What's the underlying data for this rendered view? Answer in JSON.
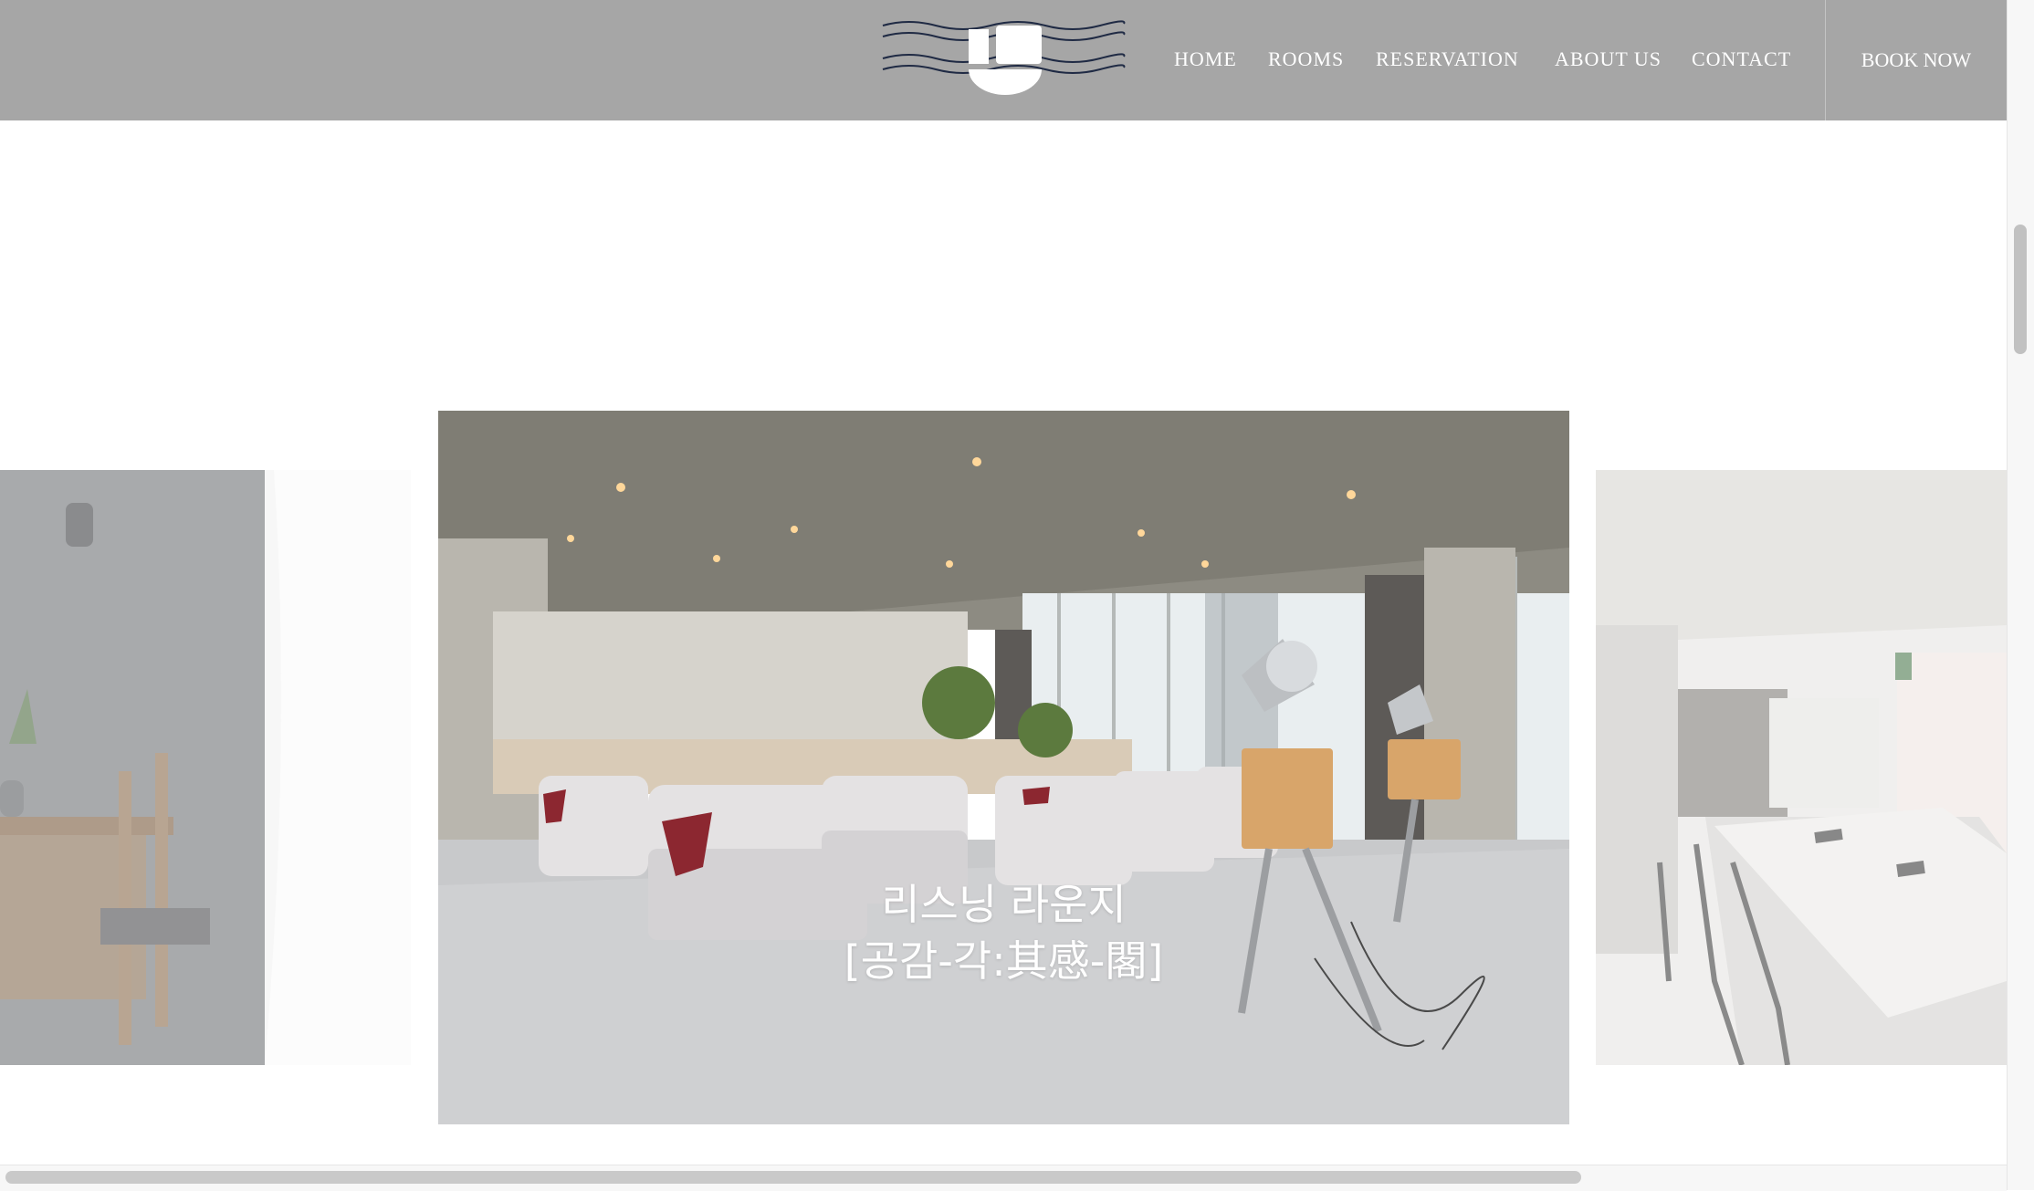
{
  "header": {
    "background": "#a6a6a6",
    "nav": [
      {
        "label": "HOME"
      },
      {
        "label": "ROOMS"
      },
      {
        "label": "RESERVATION"
      },
      {
        "label": "ABOUT US"
      },
      {
        "label": "CONTACT"
      }
    ],
    "cta_label": "BOOK NOW"
  },
  "carousel": {
    "active_slide": {
      "caption_line1": "리스닝 라운지",
      "caption_line2": "[공감-각:其感-閣]"
    },
    "side_slides": [
      "dining-room-photo",
      "meeting-room-photo"
    ]
  },
  "icons": {
    "logo": "waves-logo-icon"
  },
  "colors": {
    "nav_text": "#ffffff",
    "page_background": "#ffffff"
  }
}
